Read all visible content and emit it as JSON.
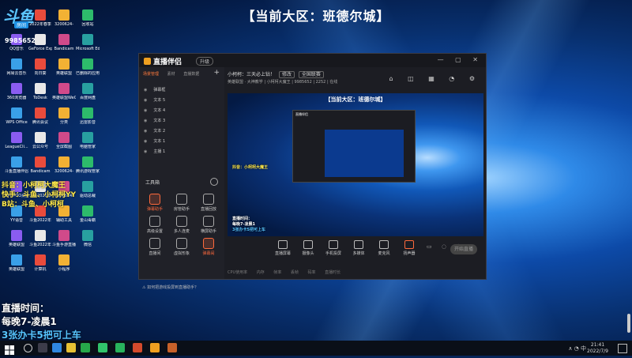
{
  "stream_title": "【当前大区：班德尔城】",
  "logo": {
    "mark": "斗鱼",
    "room_label": "房间"
  },
  "room_id": "9985652",
  "desktop_icons": [
    "WeGame",
    "2022年春季",
    "3200624-",
    "回收站",
    "QQ音乐",
    "GeForce Experience",
    "Bandicam",
    "Microsoft Edge",
    "网易云音乐",
    "向日葵",
    "英雄联盟",
    "已删除的应用",
    "360浏览器",
    "ToDesk",
    "英雄联盟WeGame版",
    "百度网盘",
    "WPS Office",
    "腾讯会议",
    "分类",
    "迅雷影音",
    "LeagueCli...",
    "云公众号",
    "全屏截图",
    "电脑管家",
    "斗鱼直播伴侣",
    "Bandicam",
    "3200624-",
    "腾讯游戏管家",
    "UPUPOO桌面",
    "斗鱼2021年",
    "3200624-",
    "驱动总裁",
    "YY语音",
    "斗鱼2022年",
    "辅助工具",
    "金山毒霸",
    "英雄联盟",
    "斗鱼2022年",
    "斗鱼手游直播",
    "微信",
    "英雄联盟",
    "计算机",
    "小程序"
  ],
  "promo": {
    "douyin": "抖音：小柯柯大魔王",
    "kuaishou": "快手：斗鱼、小柯柯YY",
    "bilibili": "B站：斗鱼、小柯柯",
    "time_label": "直播时间：",
    "time_value": "每晚7-凌晨1",
    "rule": "3张办卡5把可上车"
  },
  "app": {
    "brand": "直播伴侣",
    "version_badge": "升级",
    "window_controls": "— ▢ ✕",
    "side_tabs": [
      "场景管理",
      "素材",
      "直播数据"
    ],
    "add_symbol": "+",
    "scenes": [
      "弹幕框",
      "文本 5",
      "文本 4",
      "文本 3",
      "文本 2",
      "文本 1",
      "主播 1"
    ],
    "tools_header": "工具箱",
    "tools": [
      {
        "label": "弹幕助手",
        "active": true
      },
      {
        "label": "房管助手",
        "active": false
      },
      {
        "label": "直播回放",
        "active": false
      },
      {
        "label": "高级设置",
        "active": false
      },
      {
        "label": "多人连麦",
        "active": false
      },
      {
        "label": "横屏助手",
        "active": false
      },
      {
        "label": "直播间",
        "active": false
      },
      {
        "label": "虚拟形象",
        "active": false
      },
      {
        "label": "弹幕闹",
        "active": true
      }
    ],
    "notice": "如何把游戏投屏到直播助手？",
    "room_title": "小柯柯：三天必上钻！",
    "edit_btn": "修改",
    "category_btn": "全国联赛",
    "room_meta": "英雄联盟 · 大神教学 | 小柯柯大魔王 | 9985652 | 2252 | 在线",
    "right_tools": "⌂ ◫ ▦ ◔ ⚙",
    "preview_title": "【当前大区：班德尔城】",
    "preview_mini_brand": "直播伴侣",
    "controls": [
      "直播屏幕",
      "摄像头",
      "手机投屏",
      "多媒体",
      "麦克风",
      "扬声器"
    ],
    "right_ctrl_icons": "▭ ◌ ⚙",
    "go_live": "开始直播",
    "status_bar": "CPU使用率 内存 帧率 丢帧 码率 直播时长"
  },
  "taskbar": {
    "tray_text": "∧ ◔ 中",
    "time": "21:41",
    "date": "2022/7/9"
  },
  "colors": {
    "promo_yellow": "#ffe94a",
    "promo_blue": "#56c4ff",
    "accent_orange": "#ff6a3c",
    "app_bg": "#1e1f25"
  }
}
